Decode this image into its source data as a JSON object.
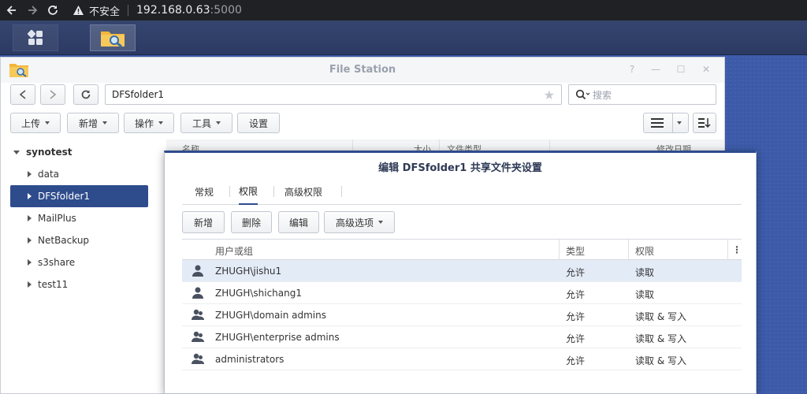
{
  "browser": {
    "security_label": "不安全",
    "url_host": "192.168.0.63",
    "url_port": ":5000"
  },
  "window": {
    "title": "File Station",
    "path": "DFSfolder1",
    "search_placeholder": "搜索",
    "toolbar": [
      "上传",
      "新增",
      "操作",
      "工具",
      "设置"
    ]
  },
  "tree": {
    "root": "synotest",
    "items": [
      "data",
      "DFSfolder1",
      "MailPlus",
      "NetBackup",
      "s3share",
      "test11"
    ],
    "selected": "DFSfolder1"
  },
  "file_list_header": {
    "name": "名称",
    "size": "大小",
    "type": "文件类型",
    "modified": "修改日期"
  },
  "dialog": {
    "title": "编辑 DFSfolder1 共享文件夹设置",
    "tabs": [
      "常规",
      "权限",
      "高级权限"
    ],
    "active_tab": "权限",
    "buttons": [
      "新增",
      "删除",
      "编辑",
      "高级选项"
    ],
    "columns": {
      "user": "用户或组",
      "type": "类型",
      "perm": "权限"
    },
    "rows": [
      {
        "kind": "user",
        "name": "ZHUGH\\jishu1",
        "type": "允许",
        "perm": "读取"
      },
      {
        "kind": "user",
        "name": "ZHUGH\\shichang1",
        "type": "允许",
        "perm": "读取"
      },
      {
        "kind": "group",
        "name": "ZHUGH\\domain admins",
        "type": "允许",
        "perm": "读取 & 写入"
      },
      {
        "kind": "group",
        "name": "ZHUGH\\enterprise admins",
        "type": "允许",
        "perm": "读取 & 写入"
      },
      {
        "kind": "group",
        "name": "administrators",
        "type": "允许",
        "perm": "读取 & 写入"
      }
    ]
  },
  "colors": {
    "selection": "#2e4c8c",
    "row_selected": "#e3ebf7",
    "desktop": "#3c5aa8"
  }
}
